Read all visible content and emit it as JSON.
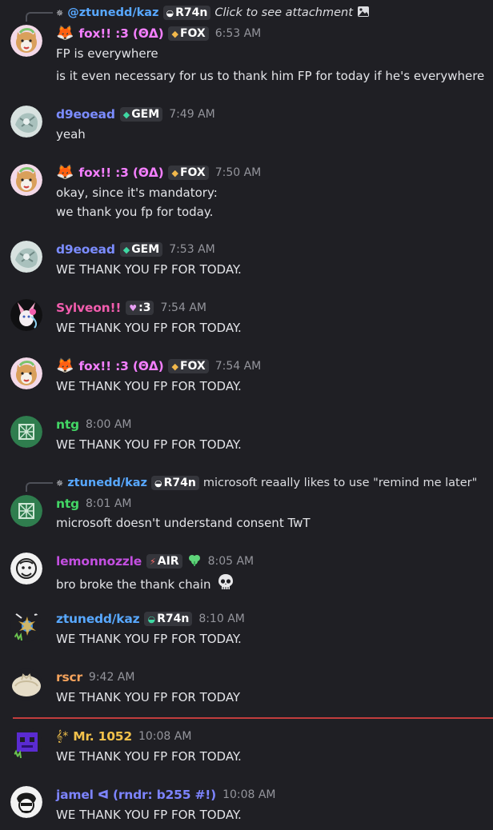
{
  "colors": {
    "fox": "#f47fff",
    "gem": "#7b8cff",
    "sylveon": "#f25dae",
    "ntg": "#43d665",
    "lemon": "#c34fe0",
    "kaz": "#58a8ff",
    "rscr": "#f5a35c",
    "mr": "#f2c14b",
    "jamel": "#7d84ff",
    "divider": "#c23d3d"
  },
  "messages": [
    {
      "reply": {
        "name": "@ztunedd/kaz",
        "tag": "R74n",
        "text": "Click to see attachment"
      },
      "author": "fox!! :3 (ΘΔ)",
      "tag": "FOX",
      "time": "6:53 AM",
      "lines": [
        "FP is everywhere",
        "is it even necessary for us to thank him FP for today if he's everywhere"
      ]
    },
    {
      "author": "d9eoead",
      "tag": "GEM",
      "time": "7:49 AM",
      "lines": [
        "yeah"
      ]
    },
    {
      "author": "fox!! :3 (ΘΔ)",
      "tag": "FOX",
      "time": "7:50 AM",
      "lines": [
        "okay, since it's mandatory:",
        "we thank you fp for today."
      ]
    },
    {
      "author": "d9eoead",
      "tag": "GEM",
      "time": "7:53 AM",
      "lines": [
        "WE THANK YOU FP FOR TODAY."
      ]
    },
    {
      "author": "Sylveon!!",
      "tag": ":3",
      "time": "7:54 AM",
      "lines": [
        "WE THANK YOU FP FOR TODAY."
      ]
    },
    {
      "author": "fox!! :3 (ΘΔ)",
      "tag": "FOX",
      "time": "7:54 AM",
      "lines": [
        "WE THANK YOU FP FOR TODAY."
      ]
    },
    {
      "author": "ntg",
      "time": "8:00 AM",
      "lines": [
        "WE THANK YOU FP FOR TODAY."
      ]
    },
    {
      "reply": {
        "name": "ztunedd/kaz",
        "tag": "R74n",
        "text": "microsoft reaally likes to use \"remind me later\""
      },
      "author": "ntg",
      "time": "8:01 AM",
      "lines": [
        "microsoft doesn't understand consent TwT"
      ]
    },
    {
      "author": "lemonnozzle",
      "tag": "AIR",
      "time": "8:05 AM",
      "lines": [
        "bro broke the thank chain"
      ]
    },
    {
      "author": "ztunedd/kaz",
      "tag": "R74n",
      "time": "8:10 AM",
      "lines": [
        "WE THANK YOU FP FOR TODAY."
      ]
    },
    {
      "author": "rscr",
      "time": "9:42 AM",
      "lines": [
        "WE THANK YOU FP FOR TODAY"
      ]
    },
    {
      "author": "Mr. 1052",
      "time": "10:08 AM",
      "lines": [
        "WE THANK YOU FP FOR TODAY."
      ]
    },
    {
      "author": "jamel ᐊ (rndr: b255 #!)",
      "time": "10:08 AM",
      "lines": [
        "WE THANK YOU FP FOR TODAY."
      ]
    }
  ]
}
